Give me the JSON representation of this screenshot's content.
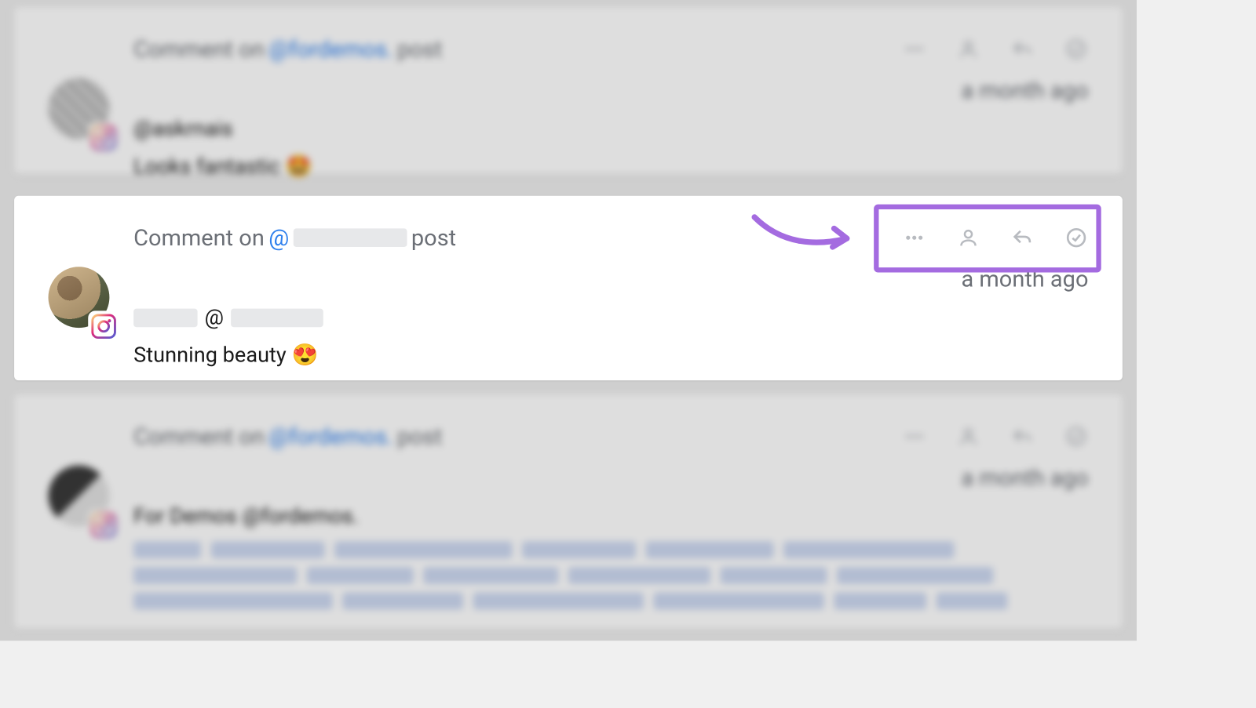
{
  "common": {
    "headline_prefix": "Comment on",
    "headline_at": "@",
    "headline_suffix": "post",
    "timeago": "a month ago"
  },
  "cards": [
    {
      "headline_account": "fordemos.",
      "username": "@askrnais",
      "body": "Looks fantastic 🤩"
    },
    {
      "headline_account": "",
      "username_prefix": "",
      "username_at": "@",
      "body": "Stunning beauty 😍"
    },
    {
      "headline_account": "fordemos.",
      "username": "For Demos @fordemos.",
      "body": ""
    }
  ]
}
